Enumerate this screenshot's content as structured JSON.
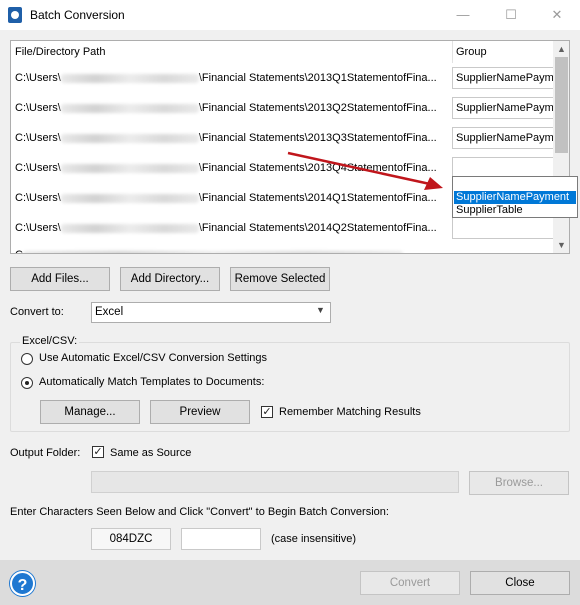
{
  "window": {
    "title": "Batch Conversion",
    "controls": {
      "minimize": "—",
      "maximize": "☐",
      "close": "✕"
    }
  },
  "file_list": {
    "columns": {
      "path": "File/Directory Path",
      "group": "Group"
    },
    "rows": [
      {
        "prefix": "C:\\Users\\",
        "suffix": "\\Financial Statements\\2013Q1StatementofFina...",
        "group": "SupplierNamePayme"
      },
      {
        "prefix": "C:\\Users\\",
        "suffix": "\\Financial Statements\\2013Q2StatementofFina...",
        "group": "SupplierNamePayme"
      },
      {
        "prefix": "C:\\Users\\",
        "suffix": "\\Financial Statements\\2013Q3StatementofFina...",
        "group": "SupplierNamePayme"
      },
      {
        "prefix": "C:\\Users\\",
        "suffix": "\\Financial Statements\\2013Q4StatementofFina...",
        "group": ""
      },
      {
        "prefix": "C:\\Users\\",
        "suffix": "\\Financial Statements\\2014Q1StatementofFina...",
        "group": ""
      },
      {
        "prefix": "C:\\Users\\",
        "suffix": "\\Financial Statements\\2014Q2StatementofFina...",
        "group": ""
      }
    ],
    "dropdown_options": [
      "SupplierNamePayment",
      "SupplierTable"
    ],
    "dropdown_selected": "SupplierNamePayment"
  },
  "actions": {
    "add_files": "Add Files...",
    "add_directory": "Add Directory...",
    "remove_selected": "Remove Selected"
  },
  "convert_to": {
    "label": "Convert to:",
    "value": "Excel"
  },
  "excel_csv": {
    "group_label": "Excel/CSV:",
    "option_auto_settings": "Use Automatic Excel/CSV Conversion Settings",
    "option_match_templates": "Automatically Match Templates to Documents:",
    "selected_option": "match_templates",
    "manage_button": "Manage...",
    "preview_button": "Preview",
    "remember_label": "Remember Matching Results",
    "remember_checked": true
  },
  "output": {
    "label": "Output Folder:",
    "same_as_source_label": "Same as Source",
    "same_as_source_checked": true,
    "path_value": "",
    "browse_button": "Browse..."
  },
  "captcha": {
    "instruction": "Enter Characters Seen Below and Click \"Convert\" to Begin Batch Conversion:",
    "code": "084DZC",
    "input_value": "",
    "hint": "(case insensitive)"
  },
  "footer": {
    "help_glyph": "?",
    "convert_button": "Convert",
    "close_button": "Close"
  },
  "colors": {
    "selection": "#0078d7",
    "arrow": "#c0161c",
    "help": "#1f78d1"
  }
}
